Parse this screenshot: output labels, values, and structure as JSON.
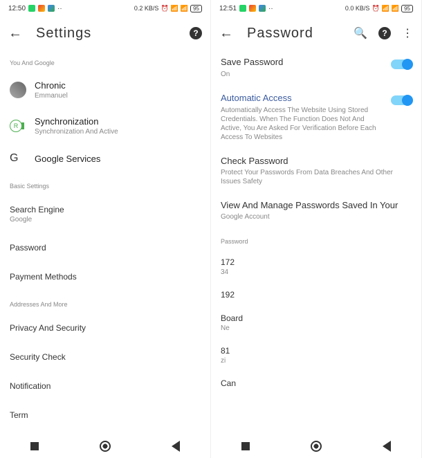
{
  "left": {
    "status": {
      "time": "12:50",
      "data_rate": "0.2 KB/S",
      "battery": "95"
    },
    "title": "Settings",
    "sections": {
      "you_google": "You And Google",
      "profile": {
        "name": "Chronic",
        "sub": "Emmanuel"
      },
      "sync": {
        "title": "Synchronization",
        "sub": "Synchronization And Active"
      },
      "google_services": "Google Services",
      "basic_label": "Basic Settings",
      "search_engine": {
        "title": "Search Engine",
        "sub": "Google"
      },
      "password": "Password",
      "payment": "Payment Methods",
      "addresses": "Addresses And More",
      "privacy": "Privacy And Security",
      "security_check": "Security Check",
      "notification": "Notification",
      "terms": "Term"
    }
  },
  "right": {
    "status": {
      "time": "12:51",
      "data_rate": "0.0 KB/S",
      "battery": "95"
    },
    "title": "Password",
    "save_password": {
      "title": "Save Password",
      "sub": "On"
    },
    "auto_access": {
      "title": "Automatic Access",
      "desc": "Automatically Access The Website Using Stored Credentials. When The Function Does Not And Active, You Are Asked For Verification Before Each Access To Websites"
    },
    "check_password": {
      "title": "Check Password",
      "desc": "Protect Your Passwords From Data Breaches And Other Issues Safety"
    },
    "view_manage": {
      "title": "View And Manage Passwords Saved In Your",
      "sub": "Google Account"
    },
    "pw_label": "Password",
    "items": [
      {
        "title": "172",
        "sub": "34"
      },
      {
        "title": "192",
        "sub": ""
      },
      {
        "title": "Board",
        "sub": "Ne"
      },
      {
        "title": "81",
        "sub": "zi"
      },
      {
        "title": "Can",
        "sub": ""
      }
    ]
  }
}
